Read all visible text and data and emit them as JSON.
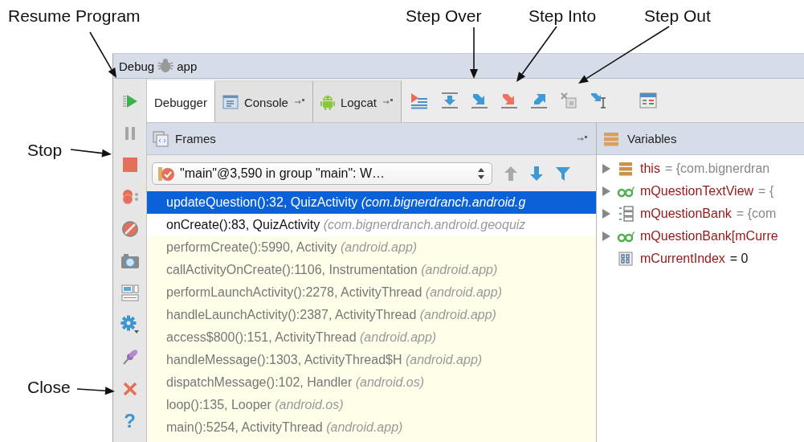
{
  "callouts": [
    {
      "label": "Resume Program",
      "kind": "resume"
    },
    {
      "label": "Step Over",
      "kind": "step_over"
    },
    {
      "label": "Step Into",
      "kind": "step_into"
    },
    {
      "label": "Step Out",
      "kind": "step_out"
    },
    {
      "label": "Stop",
      "kind": "stop"
    },
    {
      "label": "Close",
      "kind": "close"
    }
  ],
  "window": {
    "title": "Debug",
    "config": "app"
  },
  "side_toolbar": {
    "help_glyph": "?"
  },
  "tabs": [
    {
      "label": "Debugger",
      "selected": true,
      "kind": "debugger"
    },
    {
      "label": "Console",
      "selected": false,
      "kind": "console"
    },
    {
      "label": "Logcat",
      "selected": false,
      "kind": "logcat"
    }
  ],
  "frames": {
    "title": "Frames",
    "thread": "\"main\"@3,590 in group \"main\": W…",
    "rows": [
      {
        "method": "updateQuestion():32, QuizActivity",
        "package": "(com.bignerdranch.android.g",
        "selected": true,
        "kind": "user"
      },
      {
        "method": "onCreate():83, QuizActivity",
        "package": "(com.bignerdranch.android.geoquiz",
        "selected": false,
        "kind": "user"
      },
      {
        "method": "performCreate():5990, Activity",
        "package": "(android.app)",
        "selected": false,
        "kind": "library"
      },
      {
        "method": "callActivityOnCreate():1106, Instrumentation",
        "package": "(android.app)",
        "selected": false,
        "kind": "library"
      },
      {
        "method": "performLaunchActivity():2278, ActivityThread",
        "package": "(android.app)",
        "selected": false,
        "kind": "library"
      },
      {
        "method": "handleLaunchActivity():2387, ActivityThread",
        "package": "(android.app)",
        "selected": false,
        "kind": "library"
      },
      {
        "method": "access$800():151, ActivityThread",
        "package": "(android.app)",
        "selected": false,
        "kind": "library"
      },
      {
        "method": "handleMessage():1303, ActivityThread$H",
        "package": "(android.app)",
        "selected": false,
        "kind": "library"
      },
      {
        "method": "dispatchMessage():102, Handler",
        "package": "(android.os)",
        "selected": false,
        "kind": "library"
      },
      {
        "method": "loop():135, Looper",
        "package": "(android.os)",
        "selected": false,
        "kind": "library"
      },
      {
        "method": "main():5254, ActivityThread",
        "package": "(android.app)",
        "selected": false,
        "kind": "library"
      }
    ]
  },
  "variables": {
    "title": "Variables",
    "items": [
      {
        "name": "this",
        "value": "= {com.bignerdran",
        "expandable": true,
        "kind": "object"
      },
      {
        "name": "mQuestionTextView",
        "value": "= {",
        "expandable": true,
        "kind": "watch"
      },
      {
        "name": "mQuestionBank",
        "value": "= {com",
        "expandable": true,
        "kind": "array"
      },
      {
        "name": "mQuestionBank[mCurre",
        "expandable": true,
        "kind": "watch"
      },
      {
        "name": "mCurrentIndex",
        "value": "= 0",
        "expandable": false,
        "kind": "primitive"
      }
    ]
  }
}
